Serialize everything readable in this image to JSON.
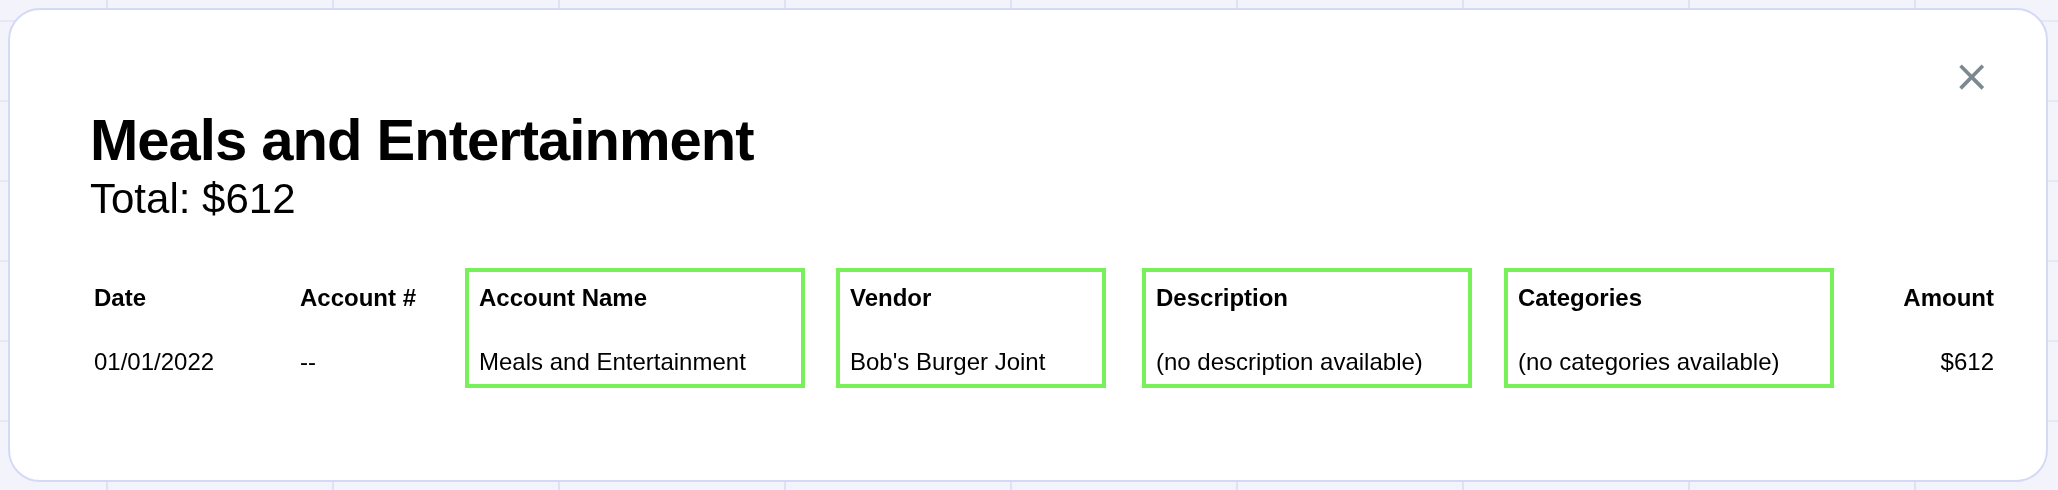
{
  "dialog": {
    "title": "Meals and Entertainment",
    "total": "Total: $612",
    "close": "×"
  },
  "table": {
    "columns": [
      {
        "label": "Date",
        "highlighted": false
      },
      {
        "label": "Account #",
        "highlighted": false
      },
      {
        "label": "Account Name",
        "highlighted": true
      },
      {
        "label": "Vendor",
        "highlighted": true
      },
      {
        "label": "Description",
        "highlighted": true
      },
      {
        "label": "Categories",
        "highlighted": true
      },
      {
        "label": "Amount",
        "highlighted": false
      }
    ],
    "rows": [
      {
        "cells": [
          "01/01/2022",
          "--",
          "Meals and Entertainment",
          "Bob's Burger Joint",
          "(no description available)",
          "(no categories available)",
          "$612"
        ]
      }
    ]
  }
}
